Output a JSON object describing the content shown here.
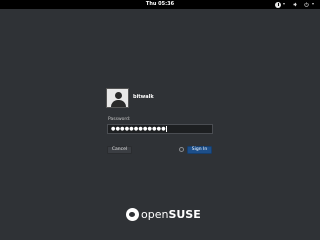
{
  "topbar": {
    "clock": "Thu 05:36",
    "icons": [
      "accessibility-icon",
      "volume-icon",
      "power-icon"
    ]
  },
  "login": {
    "username": "bitwalk",
    "password_label": "Password:",
    "password_value": "●●●●●●●●●●●●",
    "cancel_label": "Cancel",
    "signin_label": "Sign In"
  },
  "brand": {
    "logo_light": "open",
    "logo_bold": "SUSE"
  },
  "colors": {
    "background": "#2f3236",
    "topbar": "#000000",
    "signin_button": "#1d4f8a"
  }
}
